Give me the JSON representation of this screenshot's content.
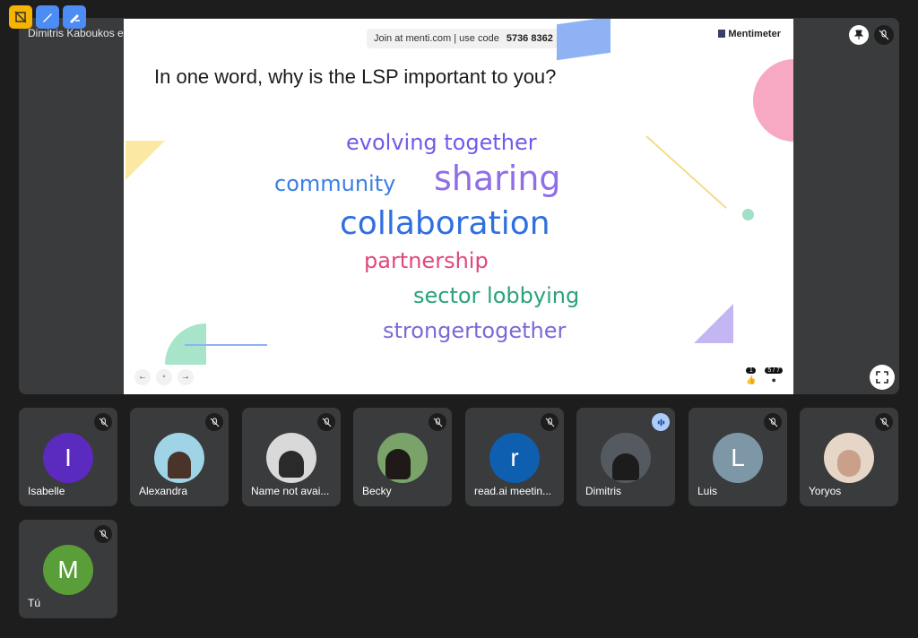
{
  "presenter_label": "Dimitris Kaboukos está mostrando su pantalla",
  "slide": {
    "join_text": "Join at menti.com | use code",
    "code": "5736 8362",
    "brand": "Mentimeter",
    "question": "In one word, why is the LSP important to you?",
    "words": [
      {
        "text": "evolving together",
        "color": "#6d5ce8"
      },
      {
        "text": "community",
        "color": "#3a7ee6"
      },
      {
        "text": "sharing",
        "color": "#8f6ee8"
      },
      {
        "text": "collaboration",
        "color": "#2f6fe0"
      },
      {
        "text": "partnership",
        "color": "#e0487a"
      },
      {
        "text": "sector lobbying",
        "color": "#2aa27a"
      },
      {
        "text": "strongertogether",
        "color": "#7a6ad8"
      }
    ],
    "reactions": {
      "likes": "1",
      "participants": "5 / 7"
    }
  },
  "participants": [
    {
      "name": "Isabelle",
      "initial": "I",
      "color": "#5b2bbf"
    },
    {
      "name": "Alexandra",
      "initial": "",
      "color": "#9fd3e6"
    },
    {
      "name": "Name not avai...",
      "initial": "",
      "color": "#bbbbbb"
    },
    {
      "name": "Becky",
      "initial": "",
      "color": "#7aa36a"
    },
    {
      "name": "read.ai meetin...",
      "initial": "r",
      "color": "#0e5fb0"
    },
    {
      "name": "Dimitris",
      "initial": "",
      "color": "#555a60"
    },
    {
      "name": "Luis",
      "initial": "L",
      "color": "#7e97a6"
    },
    {
      "name": "Yoryos",
      "initial": "",
      "color": "#c9a08a"
    },
    {
      "name": "Tú",
      "initial": "M",
      "color": "#5a9e3a"
    }
  ]
}
